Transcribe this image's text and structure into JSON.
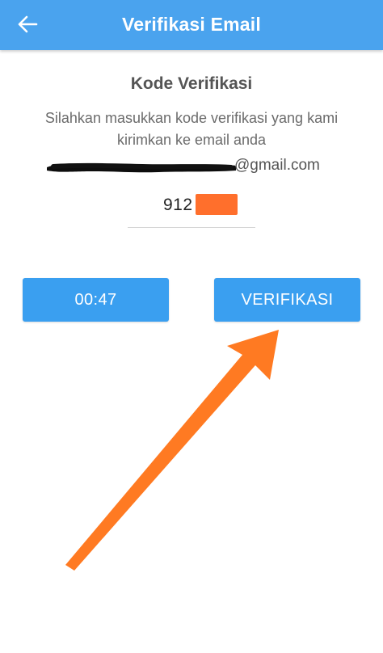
{
  "header": {
    "title": "Verifikasi Email",
    "back_icon": "arrow-left-icon",
    "color": "#4aa3ee"
  },
  "main": {
    "title": "Kode Verifikasi",
    "description": "Silahkan masukkan kode verifikasi yang kami kirimkan ke email anda",
    "email_domain": "@gmail.com",
    "code_value": "912",
    "buttons": {
      "timer_label": "00:47",
      "verify_label": "VERIFIKASI"
    }
  },
  "annotation": {
    "arrow_color": "#ff7a22",
    "redaction_color": "#ff6f2c"
  }
}
